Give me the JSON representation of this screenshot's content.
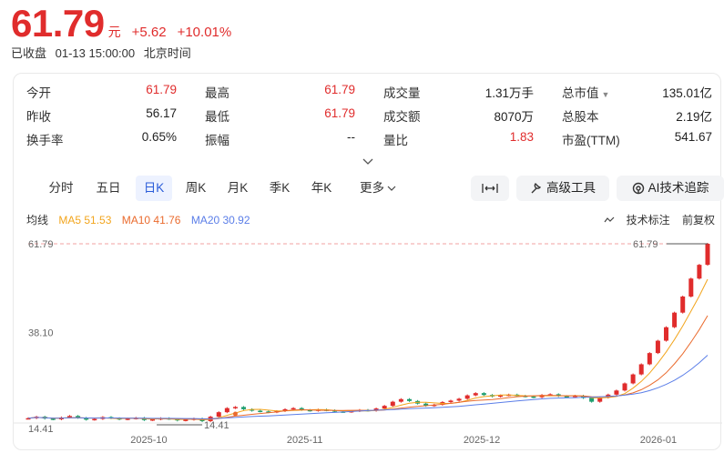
{
  "quote": {
    "price": "61.79",
    "currency": "元",
    "change": "+5.62",
    "change_pct": "+10.01%",
    "status": "已收盘",
    "datetime": "01-13 15:00:00",
    "timezone": "北京时间"
  },
  "stats": {
    "row1": [
      {
        "label": "今开",
        "value": "61.79",
        "red": true
      },
      {
        "label": "最高",
        "value": "61.79",
        "red": true
      },
      {
        "label": "成交量",
        "value": "1.31万手",
        "red": false
      },
      {
        "label": "总市值",
        "value": "135.01亿",
        "red": false
      }
    ],
    "row2": [
      {
        "label": "昨收",
        "value": "56.17",
        "red": false
      },
      {
        "label": "最低",
        "value": "61.79",
        "red": true
      },
      {
        "label": "成交额",
        "value": "8070万",
        "red": false
      },
      {
        "label": "总股本",
        "value": "2.19亿",
        "red": false
      }
    ],
    "row3": [
      {
        "label": "换手率",
        "value": "0.65%",
        "red": false
      },
      {
        "label": "振幅",
        "value": "--",
        "red": false
      },
      {
        "label": "量比",
        "value": "1.83",
        "red": true
      },
      {
        "label": "市盈(TTM)",
        "value": "541.67",
        "red": false
      }
    ]
  },
  "tabs": [
    "分时",
    "五日",
    "日K",
    "周K",
    "月K",
    "季K",
    "年K",
    "更多"
  ],
  "active_tab": "日K",
  "tools": {
    "fit_label": "|↔|",
    "advanced_label": "高级工具",
    "ai_label": "AI技术追踪"
  },
  "ma": {
    "label": "均线",
    "ma5": "MA5 51.53",
    "ma10": "MA10 41.76",
    "ma20": "MA20 30.92",
    "tech_label": "技术标注",
    "adjust_label": "前复权"
  },
  "colors": {
    "up": "#e02c2c",
    "down": "#1e9e6e",
    "ma5": "#f2a51d",
    "ma10": "#ea6b2e",
    "ma20": "#5b7ee8",
    "accent": "#2a5cd9"
  },
  "chart_data": {
    "type": "candlestick",
    "y_ticks": [
      "61.79",
      "38.10",
      "14.41"
    ],
    "ylim": [
      14.41,
      61.79
    ],
    "x_ticks": [
      "2025-10",
      "2025-11",
      "2025-12",
      "2026-01"
    ],
    "max_label": "61.79",
    "min_label": "14.41",
    "last_close": 61.79,
    "closes": [
      15.2,
      15.6,
      15.1,
      14.9,
      15.4,
      15.8,
      15.3,
      14.8,
      15.0,
      15.5,
      15.2,
      14.9,
      15.1,
      15.3,
      14.7,
      14.9,
      15.2,
      15.0,
      14.6,
      14.8,
      15.1,
      14.41,
      15.6,
      16.8,
      17.9,
      18.2,
      17.6,
      17.2,
      17.0,
      16.8,
      17.1,
      17.6,
      17.9,
      17.4,
      17.2,
      17.5,
      17.3,
      17.0,
      16.9,
      17.1,
      17.4,
      17.2,
      17.8,
      18.5,
      19.6,
      20.3,
      19.8,
      19.1,
      18.5,
      18.8,
      19.5,
      19.9,
      20.4,
      21.3,
      21.9,
      21.4,
      21.0,
      21.3,
      21.5,
      21.2,
      21.0,
      20.8,
      21.4,
      21.6,
      21.1,
      20.9,
      21.2,
      20.6,
      19.6,
      20.7,
      21.5,
      22.6,
      24.5,
      26.9,
      29.6,
      32.6,
      35.9,
      39.5,
      43.4,
      47.7,
      52.5,
      56.17,
      61.79
    ],
    "ma5_end": 51.53,
    "ma10_end": 41.76,
    "ma20_end": 30.92
  }
}
